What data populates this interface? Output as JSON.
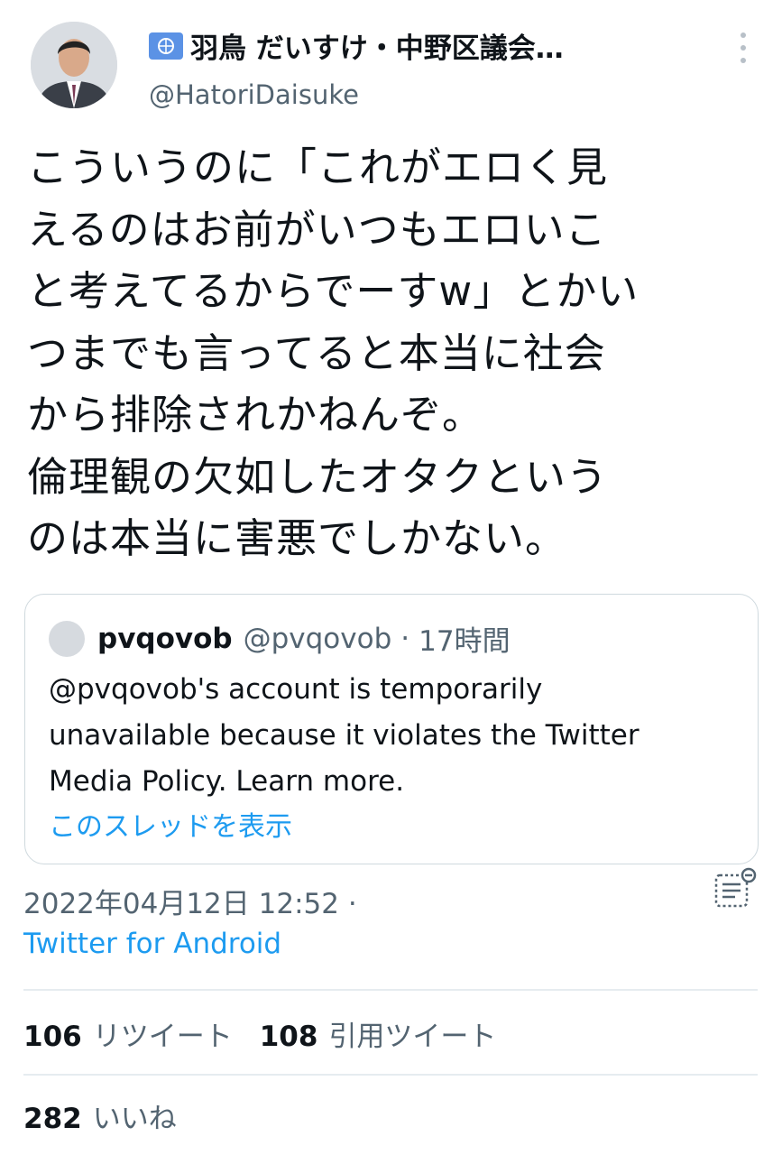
{
  "author": {
    "display_name": "羽鳥 だいすけ・中野区議会…",
    "handle": "@HatoriDaisuke",
    "badge_icon": "un-flag-icon",
    "avatar": "profile-photo-avatar"
  },
  "tweet": {
    "text_lines": [
      "こういうのに「これがエロく見",
      "えるのはお前がいつもエロいこ",
      "と考えてるからでーすw」とかい",
      "つまでも言ってると本当に社会",
      "から排除されかねんぞ。",
      "倫理観の欠如したオタクという",
      "のは本当に害悪でしかない。"
    ]
  },
  "quote": {
    "name": "pvqovob",
    "handle": "@pvqovob",
    "separator": "·",
    "time": "17時間",
    "body_lines": [
      "@pvqovob's account is temporarily",
      "unavailable because it violates the Twitter",
      "Media Policy. Learn more."
    ],
    "thread_link": "このスレッドを表示"
  },
  "meta": {
    "date": "2022年04月12日 12:52 ·",
    "source": "Twitter for Android",
    "view_icon": "tweet-activity-icon"
  },
  "stats": {
    "retweets_count": "106",
    "retweets_label": "リツイート",
    "quotes_count": "108",
    "quotes_label": "引用ツイート",
    "likes_count": "282",
    "likes_label": "いいね"
  },
  "colors": {
    "text": "#0f1419",
    "secondary": "#536471",
    "link": "#1d9bf0",
    "border": "#cfd9de"
  }
}
